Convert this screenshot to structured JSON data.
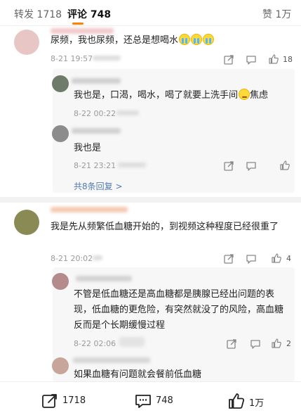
{
  "tabs": {
    "repost_label": "转发",
    "repost_count": "1718",
    "comment_label": "评论",
    "comment_count": "748",
    "like_label": "赞",
    "like_count": "1万"
  },
  "comments": [
    {
      "text": "尿频，我也尿频，还总是想喝水",
      "emoji": "crying-emoji",
      "time": "8-21 19:57",
      "likes": "18",
      "replies": [
        {
          "text": "我也是，口渴，喝水，喝了就要上洗手间",
          "suffix": "焦虑",
          "time": "8-22 00:22"
        },
        {
          "text": "我也是",
          "time": "8-21 23:21"
        }
      ],
      "more_replies": "共8条回复 >"
    },
    {
      "text": "我是先从频繁低血糖开始的，到视频这种程度已经很重了",
      "time": "8-21 20:02",
      "likes": "4",
      "replies": [
        {
          "text": "不管是低血糖还是高血糖都是胰腺已经出问题的表现，低血糖的更危险，有突然就没了的风险，高血糖反而是个长期缓慢过程",
          "time": "8-22 02:06",
          "likes": "2"
        },
        {
          "text": "如果血糖有问题就会餐前低血糖"
        }
      ]
    }
  ],
  "bottom_bar": {
    "repost_count": "1718",
    "comment_count": "748",
    "like_count": "1万"
  },
  "colors": {
    "accent": "#ff8200",
    "link": "#507daf",
    "meta": "#9a9a9a"
  }
}
